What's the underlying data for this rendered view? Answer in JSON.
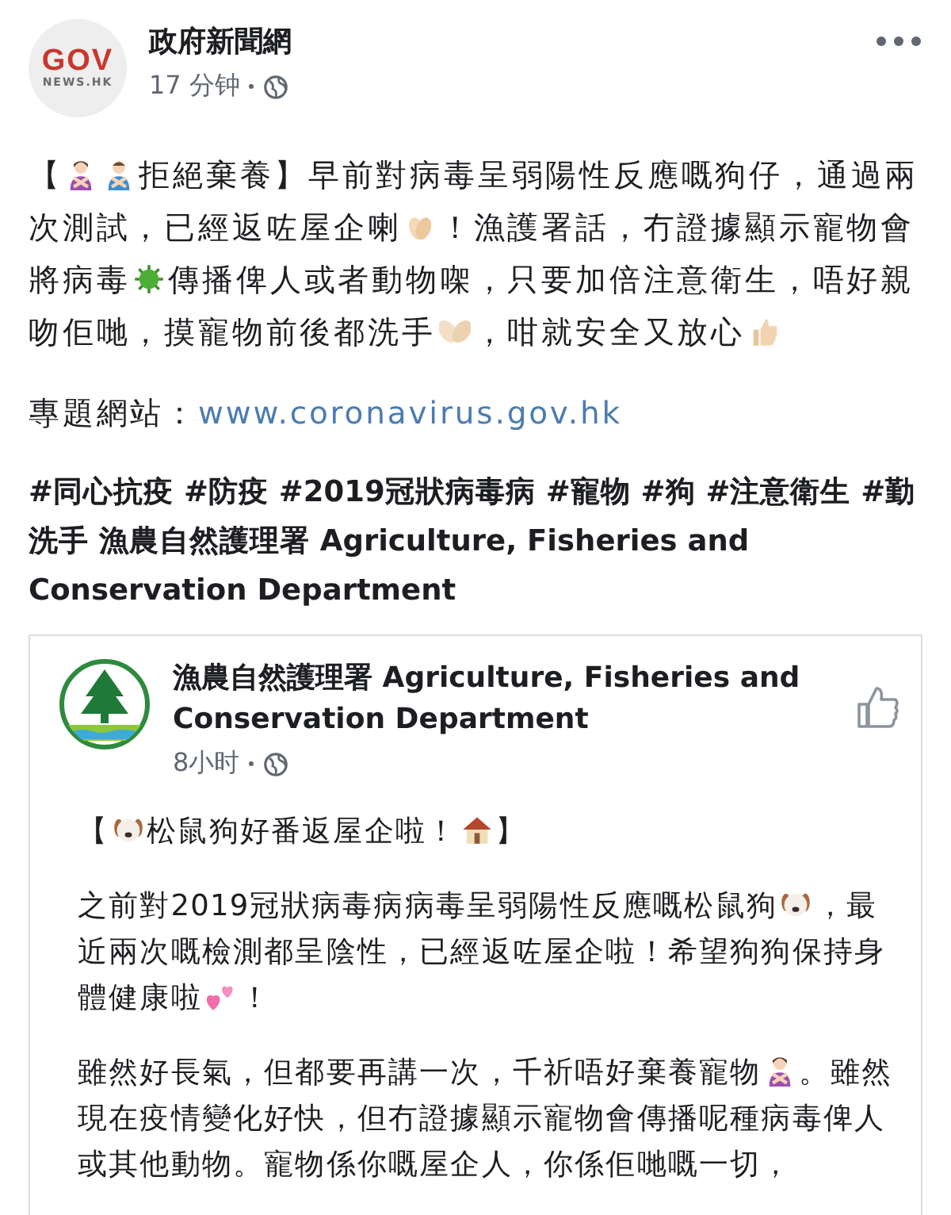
{
  "post": {
    "author": {
      "logo_top": "GOV",
      "logo_bottom": "NEWS.HK",
      "name": "政府新聞網"
    },
    "time": "17 分钟",
    "paragraphs": [
      {
        "kind": "body",
        "parts": [
          {
            "text": "【"
          },
          {
            "kind": "woman"
          },
          {
            "kind": "man"
          },
          {
            "text": "拒絕棄養】早前對病毒呈弱陽性反應嘅狗仔，通過兩次測試，已經返咗屋企喇"
          },
          {
            "kind": "clap"
          },
          {
            "text": "！漁護署話，冇證據顯示寵物會將病毒"
          },
          {
            "kind": "virus"
          },
          {
            "text": "傳播俾人或者動物㗎，只要加倍注意衛生，唔好親吻佢哋，摸寵物前後都洗手"
          },
          {
            "kind": "hands"
          },
          {
            "text": "，咁就安全又放心"
          },
          {
            "kind": "thumb"
          }
        ]
      },
      {
        "kind": "link",
        "label": "專題網站：",
        "url": "www.coronavirus.gov.hk"
      },
      {
        "kind": "tags",
        "parts": [
          {
            "text": "#同心抗疫 #防疫 #2019冠狀病毒病 #寵物 #狗 #注意衛生 #勤洗手 漁農自然護理署 Agriculture, Fisheries and Conservation Department"
          }
        ]
      }
    ]
  },
  "shared": {
    "author": {
      "name": "漁農自然護理署 Agriculture, Fisheries and Conservation Department"
    },
    "time": "8小时",
    "paragraphs": [
      {
        "kind": "body",
        "parts": [
          {
            "text": "【"
          },
          {
            "kind": "dog"
          },
          {
            "text": "松鼠狗好番返屋企啦！"
          },
          {
            "kind": "house"
          },
          {
            "text": "】"
          }
        ]
      },
      {
        "kind": "body",
        "parts": [
          {
            "text": "之前對2019冠狀病毒病病毒呈弱陽性反應嘅松鼠狗"
          },
          {
            "kind": "dog"
          },
          {
            "text": "，最近兩次嘅檢測都呈陰性，已經返咗屋企啦！希望狗狗保持身體健康啦"
          },
          {
            "kind": "hearts"
          },
          {
            "text": "！"
          }
        ]
      },
      {
        "kind": "body",
        "parts": [
          {
            "text": "雖然好長氣，但都要再講一次，千祈唔好棄養寵物"
          },
          {
            "kind": "woman"
          },
          {
            "text": "。雖然現在疫情變化好快，但冇證據顯示寵物會傳播呢種病毒俾人或其他動物。寵物係你嘅屋企人，你係佢哋嘅一切，"
          }
        ]
      }
    ]
  }
}
